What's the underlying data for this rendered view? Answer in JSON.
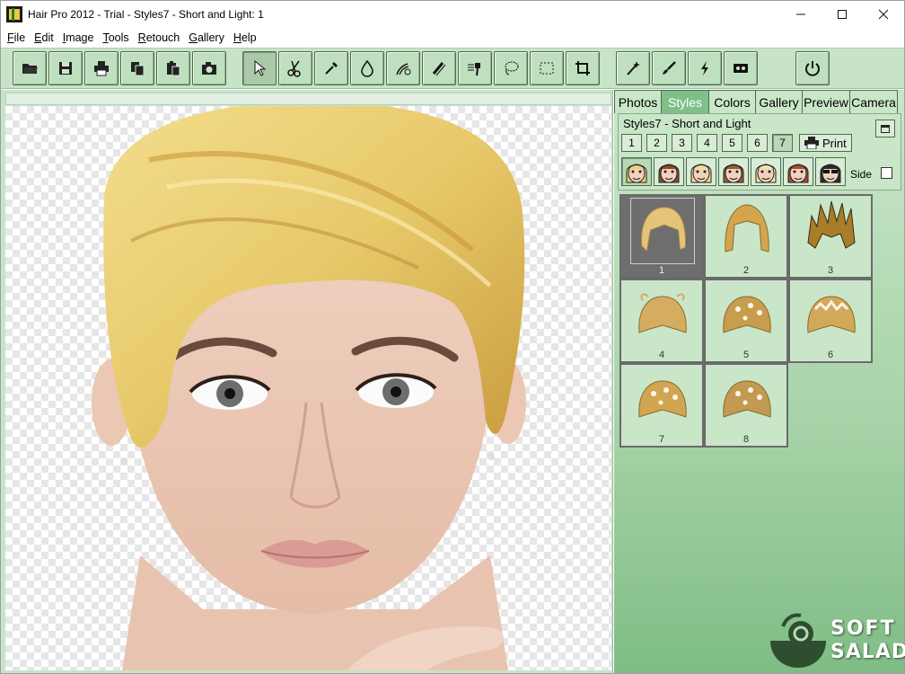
{
  "window": {
    "title": "Hair Pro 2012 - Trial - Styles7 - Short and Light: 1"
  },
  "menu": [
    {
      "label": "File",
      "u": "F",
      "rest": "ile"
    },
    {
      "label": "Edit",
      "u": "E",
      "rest": "dit"
    },
    {
      "label": "Image",
      "u": "I",
      "rest": "mage"
    },
    {
      "label": "Tools",
      "u": "T",
      "rest": "ools"
    },
    {
      "label": "Retouch",
      "u": "R",
      "rest": "etouch"
    },
    {
      "label": "Gallery",
      "u": "G",
      "rest": "allery"
    },
    {
      "label": "Help",
      "u": "H",
      "rest": "elp"
    }
  ],
  "toolbar": {
    "icons": [
      "open-folder-icon",
      "save-icon",
      "print-icon",
      "copy-icon",
      "paste-icon",
      "camera-icon",
      "select-arrow-icon",
      "scissors-icon",
      "eyedropper-icon",
      "drop-icon",
      "hair-brush-icon",
      "comb-icon",
      "hair-dryer-icon",
      "lasso-icon",
      "rect-select-icon",
      "crop-icon",
      "magic-wand-icon",
      "paintbrush-icon",
      "lightning-icon",
      "tape-icon",
      "power-icon"
    ]
  },
  "panel": {
    "tabs": [
      "Photos",
      "Styles",
      "Colors",
      "Gallery",
      "Preview",
      "Camera"
    ],
    "active_tab": "Styles",
    "style_title": "Styles7 - Short and Light",
    "numbers": [
      "1",
      "2",
      "3",
      "4",
      "5",
      "6",
      "7"
    ],
    "selected_number": "7",
    "print_label": "Print",
    "side_label": "Side",
    "faces": [
      "face-blonde-curly",
      "face-brunette",
      "face-blonde-short",
      "face-brunette-long",
      "face-blonde-light",
      "face-red-hair",
      "face-sunglasses"
    ],
    "gallery": [
      {
        "caption": "1",
        "selected": true,
        "hair": "#e4c47a",
        "style": "short"
      },
      {
        "caption": "2",
        "selected": false,
        "hair": "#d2a54e",
        "style": "bob"
      },
      {
        "caption": "3",
        "selected": false,
        "hair": "#a77d2a",
        "style": "spiky"
      },
      {
        "caption": "4",
        "selected": false,
        "hair": "#d6ad60",
        "style": "updo"
      },
      {
        "caption": "5",
        "selected": false,
        "hair": "#c99d4e",
        "style": "updo-flowers"
      },
      {
        "caption": "6",
        "selected": false,
        "hair": "#d3a85a",
        "style": "tiara"
      },
      {
        "caption": "7",
        "selected": false,
        "hair": "#d2a552",
        "style": "updo-flowers"
      },
      {
        "caption": "8",
        "selected": false,
        "hair": "#c29a52",
        "style": "updo-flowers"
      }
    ]
  },
  "watermark": {
    "line1": "SOFT",
    "line2": "SALAD"
  },
  "colors": {
    "panel": "#c9e6c9",
    "active_tab": "#7fbf8a",
    "border": "#4e6b4e",
    "hair": "#e7c96a"
  }
}
